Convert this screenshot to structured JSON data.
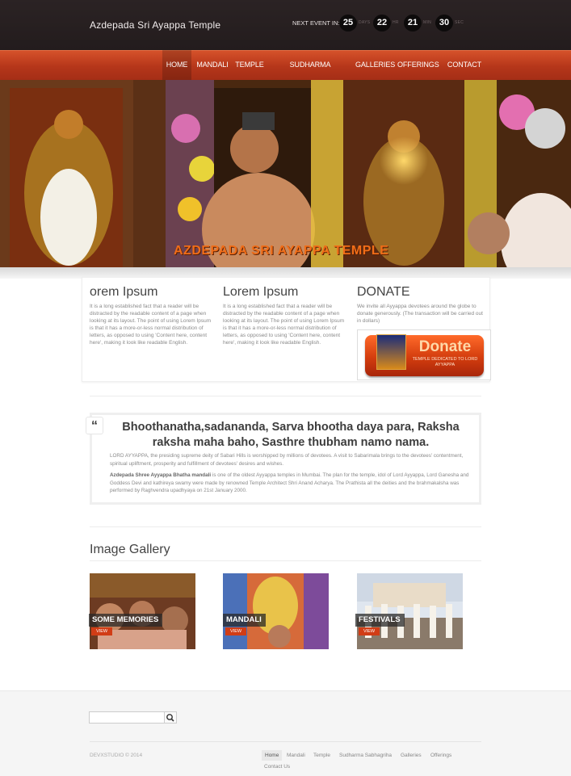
{
  "header": {
    "site_title": "Azdepada Sri Ayappa Temple",
    "next_event_label": "NEXT EVENT IN:",
    "countdown": [
      {
        "value": "25",
        "unit": "DAYS"
      },
      {
        "value": "22",
        "unit": "HR"
      },
      {
        "value": "21",
        "unit": "MIN"
      },
      {
        "value": "30",
        "unit": "SEC"
      }
    ]
  },
  "nav": {
    "items": [
      "HOME",
      "MANDALI",
      "TEMPLE",
      "SUDHARMA SABHAGRIHA",
      "GALLERIES",
      "OFFERINGS",
      "CONTACT US"
    ],
    "active": "HOME"
  },
  "hero": {
    "caption": "AZDEPADA SRI AYAPPA TEMPLE"
  },
  "columns": [
    {
      "title": "orem Ipsum",
      "text": "It is a long established fact that a reader will be distracted by the readable content of a page when looking at its layout. The point of using Lorem Ipsum is that it has a more-or-less normal distribution of letters, as opposed to using 'Content here, content here', making it look like readable English."
    },
    {
      "title": "Lorem Ipsum",
      "text": "It is a long established fact that a reader will be distracted by the readable content of a page when looking at its layout. The point of using Lorem Ipsum is that it has a more-or-less normal distribution of letters, as opposed to using 'Content here, content here', making it look like readable English."
    },
    {
      "title": "DONATE",
      "text": "We invite all Ayyappa devotees around the globe to donate generously. (The transaction will be carried out in dollars)"
    }
  ],
  "donate_button": {
    "label": "Donate",
    "sub": "TEMPLE DEDICATED TO LORD AYYAPPA"
  },
  "quote": {
    "icon": "“",
    "heading": "Bhoothanatha,sadananda, Sarva bhootha daya para, Raksha raksha maha baho, Sasthre thubham namo nama.",
    "para1": "LORD AYYAPPA, the presiding supreme deity of Sabari Hills is worshipped by millions of devotees. A visit to Sabarimala brings to the devotees' contentment, spiritual upliftment, prosperity and fulfillment of devotees' desires and wishes.",
    "para2_bold": "Azdepada Shree Ayyappa Bhatha mandali",
    "para2_rest": " is one of the oldest Ayyappa temples in Mumbai. The plan for the temple, idol of Lord Ayyappa, Lord Ganesha and Goddess Devi and kathireya swamy were made by renowned Temple Architect Shri Anand Acharya. The Prathista all the deities and the brahmakalsha was performed by Raghvendra upadhyaya on 21st January 2000."
  },
  "gallery": {
    "title": "Image Gallery",
    "items": [
      {
        "label": "SOME MEMORIES",
        "button": "VIEW"
      },
      {
        "label": "MANDALI",
        "button": "VIEW"
      },
      {
        "label": "FESTIVALS",
        "button": "VIEW"
      }
    ]
  },
  "footer": {
    "search_placeholder": "",
    "copyright": "DEVXSTUDIO © 2014",
    "links": [
      "Home",
      "Mandali",
      "Temple",
      "Sudharma Sabhagriha",
      "Galleries",
      "Offerings",
      "Contact Us"
    ]
  },
  "colors": {
    "nav_orange": "#c2401c",
    "header_dark": "#2b2324",
    "caption_orange": "#f06d18"
  }
}
